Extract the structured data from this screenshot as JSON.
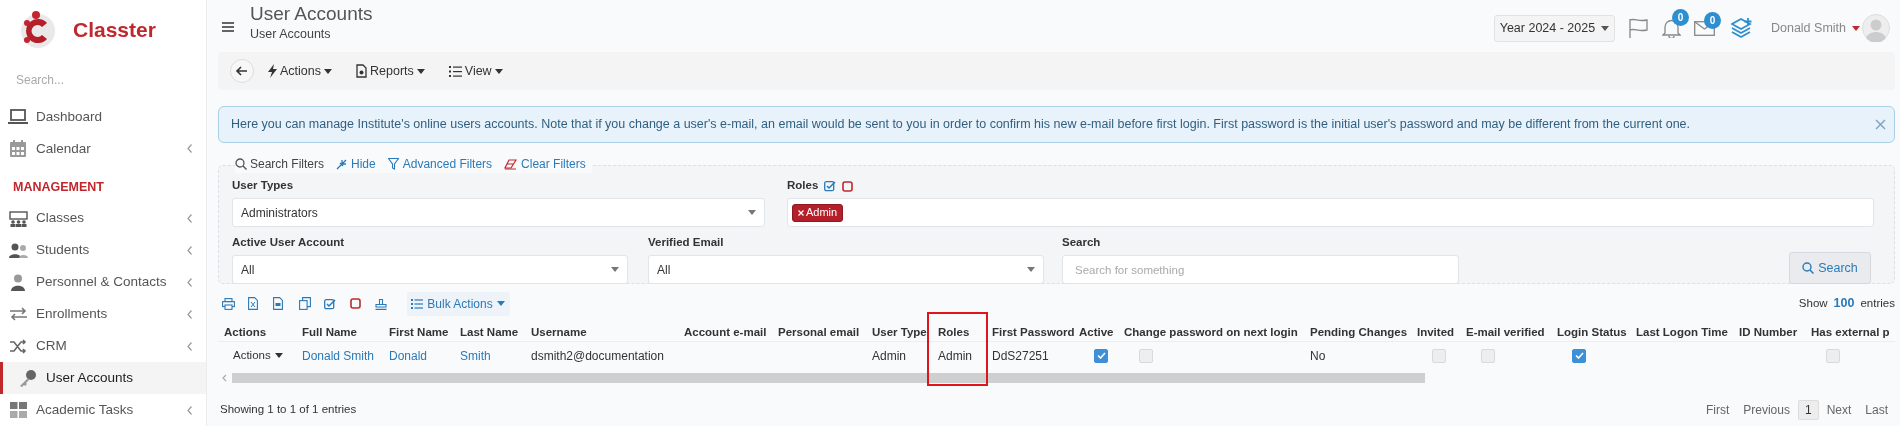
{
  "sidebar": {
    "brand": "Classter",
    "search_placeholder": "Search...",
    "items": [
      {
        "kind": "item",
        "label": "Dashboard",
        "expandable": false,
        "selected": false
      },
      {
        "kind": "item",
        "label": "Calendar",
        "expandable": true,
        "selected": false
      },
      {
        "kind": "section",
        "label": "MANAGEMENT"
      },
      {
        "kind": "item",
        "label": "Classes",
        "expandable": true,
        "selected": false
      },
      {
        "kind": "item",
        "label": "Students",
        "expandable": true,
        "selected": false
      },
      {
        "kind": "item",
        "label": "Personnel & Contacts",
        "expandable": true,
        "selected": false
      },
      {
        "kind": "item",
        "label": "Enrollments",
        "expandable": true,
        "selected": false
      },
      {
        "kind": "item",
        "label": "CRM",
        "expandable": true,
        "selected": false
      },
      {
        "kind": "item",
        "label": "User Accounts",
        "expandable": false,
        "selected": true
      },
      {
        "kind": "item",
        "label": "Academic Tasks",
        "expandable": true,
        "selected": false
      }
    ]
  },
  "header": {
    "title": "User Accounts",
    "subtitle": "User Accounts"
  },
  "top_bar": {
    "year": "Year 2024 - 2025",
    "notifications": "0",
    "messages": "0",
    "user": "Donald Smith"
  },
  "toolbar": [
    {
      "label": "Actions"
    },
    {
      "label": "Reports"
    },
    {
      "label": "View"
    }
  ],
  "alert": {
    "text": "Here you can manage Institute's online users accounts. Note that if you change a user's e-mail, an email would be sent to you in order to confirm his new e-mail before first login. First password is the initial user's password and may be different from the current one."
  },
  "filters": {
    "title": "Search Filters",
    "links": [
      "Hide",
      "Advanced Filters",
      "Clear Filters"
    ],
    "fields": [
      {
        "kind": "select",
        "label": "User Types",
        "value": "Administrators"
      },
      {
        "kind": "tags",
        "label": "Roles",
        "tags": [
          "Admin"
        ]
      },
      {
        "kind": "select",
        "label": "Active User Account",
        "value": "All"
      },
      {
        "kind": "select",
        "label": "Verified Email",
        "value": "All"
      },
      {
        "kind": "text",
        "label": "Search",
        "placeholder": "Search for something"
      }
    ],
    "search_button": "Search"
  },
  "table": {
    "bulk_actions": "Bulk Actions",
    "show_label": "Show",
    "page_size": "100",
    "entries_label": "entries",
    "columns": [
      {
        "label": "Actions",
        "highlighted": false
      },
      {
        "label": "Full Name",
        "highlighted": false
      },
      {
        "label": "First Name",
        "highlighted": false
      },
      {
        "label": "Last Name",
        "highlighted": false
      },
      {
        "label": "Username",
        "highlighted": false
      },
      {
        "label": "Account e-mail",
        "highlighted": false
      },
      {
        "label": "Personal email",
        "highlighted": false
      },
      {
        "label": "User Type",
        "highlighted": false
      },
      {
        "label": "Roles",
        "highlighted": true
      },
      {
        "label": "First Password",
        "highlighted": false
      },
      {
        "label": "Active",
        "highlighted": false
      },
      {
        "label": "Change password on next login",
        "highlighted": false
      },
      {
        "label": "Pending Changes",
        "highlighted": false
      },
      {
        "label": "Invited",
        "highlighted": false
      },
      {
        "label": "E-mail verified",
        "highlighted": false
      },
      {
        "label": "Login Status",
        "highlighted": false
      },
      {
        "label": "Last Logon Time",
        "highlighted": false
      },
      {
        "label": "ID Number",
        "highlighted": false
      },
      {
        "label": "Has external p",
        "highlighted": false
      }
    ],
    "rows": [
      {
        "cells": [
          {
            "kind": "menu",
            "text": "Actions"
          },
          {
            "kind": "link",
            "text": "Donald Smith"
          },
          {
            "kind": "link",
            "text": "Donald"
          },
          {
            "kind": "link",
            "text": "Smith"
          },
          {
            "kind": "text",
            "text": "dsmith2@documentation"
          },
          {
            "kind": "empty"
          },
          {
            "kind": "empty"
          },
          {
            "kind": "text",
            "text": "Admin"
          },
          {
            "kind": "text",
            "text": "Admin"
          },
          {
            "kind": "text",
            "text": "DdS27251"
          },
          {
            "kind": "checkbox",
            "checked": true
          },
          {
            "kind": "checkbox",
            "checked": false
          },
          {
            "kind": "text",
            "text": "No"
          },
          {
            "kind": "checkbox",
            "checked": false
          },
          {
            "kind": "checkbox",
            "checked": false
          },
          {
            "kind": "checkbox",
            "checked": true
          },
          {
            "kind": "empty"
          },
          {
            "kind": "empty"
          },
          {
            "kind": "checkbox",
            "checked": false
          }
        ]
      }
    ],
    "info": "Showing 1 to 1 of 1 entries",
    "pagination": [
      {
        "label": "First",
        "selected": false
      },
      {
        "label": "Previous",
        "selected": false
      },
      {
        "label": "1",
        "selected": true
      },
      {
        "label": "Next",
        "selected": false
      },
      {
        "label": "Last",
        "selected": false
      }
    ]
  }
}
